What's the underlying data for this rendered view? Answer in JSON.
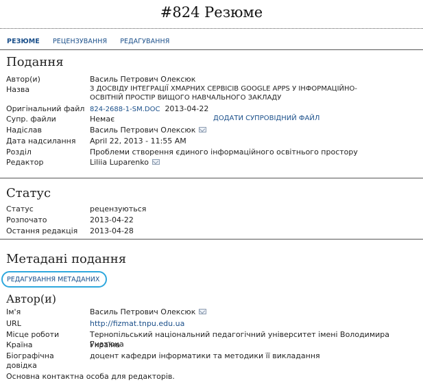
{
  "page": {
    "title": "#824 Резюме"
  },
  "tabs": [
    "РЕЗЮМЕ",
    "РЕЦЕНЗУВАННЯ",
    "РЕДАГУВАННЯ"
  ],
  "submission": {
    "heading": "Подання",
    "author_label": "Автор(и)",
    "author_value": "Василь Петрович Олексюк",
    "title_label": "Назва",
    "title_value_line1": "З ДОСВІДУ ІНТЕГРАЦІЇ ХМАРНИХ СЕРВІСІВ GOOGLE APPS У ІНФОРМАЦІЙНО-",
    "title_value_line2": "ОСВІТНІЙ ПРОСТІР ВИЩОГО НАВЧАЛЬНОГО ЗАКЛАДУ",
    "orig_file_label": "Оригінальний файл",
    "orig_file_link": "824-2688-1-SM.DOC",
    "orig_file_date": "2013-04-22",
    "supp_label": "Супр. файли",
    "supp_value": "Немає",
    "supp_add_link": "ДОДАТИ СУПРОВІДНИЙ ФАЙЛ",
    "sender_label": "Надіслав",
    "sender_value": "Василь Петрович Олексюк",
    "date_label": "Дата надсилання",
    "date_value": "April 22, 2013 - 11:55 AM",
    "section_label": "Розділ",
    "section_value": "Проблеми створення єдиного інформаційного освітнього простору",
    "editor_label": "Редактор",
    "editor_value": "Liliia Luparenko"
  },
  "status": {
    "heading": "Статус",
    "status_label": "Статус",
    "status_value": "рецензуються",
    "started_label": "Розпочато",
    "started_value": "2013-04-22",
    "last_edit_label": "Остання редакція",
    "last_edit_value": "2013-04-28"
  },
  "metadata": {
    "heading": "Метадані подання",
    "edit_link": "РЕДАГУВАННЯ МЕТАДАНИХ",
    "authors_heading": "Автор(и)",
    "name_label": "Ім'я",
    "name_value": "Василь Петрович Олексюк",
    "url_label": "URL",
    "url_value": "http://fizmat.tnpu.edu.ua",
    "workplace_label": "Місце роботи",
    "workplace_value": "Тернопільський національний педагогічний університет імені Володимира Гнатюка",
    "country_label": "Країна",
    "country_value": "Україна",
    "bio_label_line1": "Біографічна",
    "bio_label_line2": "довідка",
    "bio_value": "доцент кафедри інформатики та методики її викладання",
    "contact_note": "Основна контактна особа для редакторів."
  },
  "colors": {
    "link": "#1a4f8a",
    "highlight_ring": "#2da7dd"
  },
  "icons": {
    "email": "envelope-icon"
  }
}
